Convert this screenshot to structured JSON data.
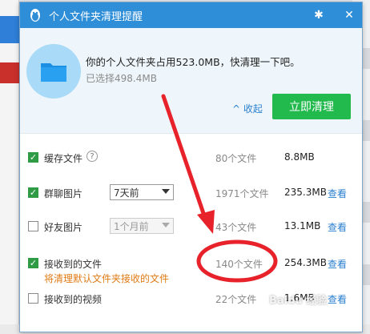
{
  "dialog": {
    "title": "个人文件夹清理提醒",
    "header": {
      "main_text": "你的个人文件夹占用523.0MB，快清理一下吧。",
      "selected_text": "已选择498.4MB",
      "collapse_label": "收起",
      "clean_button": "立即清理"
    },
    "rows": [
      {
        "label": "缓存文件",
        "checked": true,
        "count": "80个文件",
        "size": "8.8MB",
        "view": ""
      },
      {
        "label": "群聊图片",
        "checked": true,
        "select": "7天前",
        "count": "1971个文件",
        "size": "235.3MB",
        "view": "查看"
      },
      {
        "label": "好友图片",
        "checked": false,
        "select": "1个月前",
        "count": "43个文件",
        "size": "13.1MB",
        "view": "查看"
      },
      {
        "label": "接收到的文件",
        "checked": true,
        "count": "140个文件",
        "size": "254.3MB",
        "view": "查看",
        "note": "将清理默认文件夹接收的文件"
      },
      {
        "label": "接收到的视频",
        "checked": false,
        "count": "22个文件",
        "size": "1.6MB",
        "view": "查看"
      }
    ]
  },
  "colors": {
    "titlebar": "#2f8ed8",
    "clean_button": "#22b94d",
    "link": "#2a7fd0",
    "annotation": "#e8222a",
    "note": "#e07a14"
  },
  "watermark": "Baidu 经验"
}
